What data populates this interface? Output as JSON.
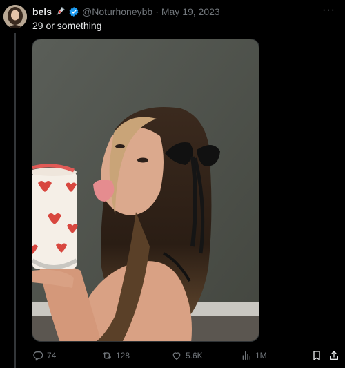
{
  "tweet": {
    "author_name": "bels",
    "handle": "@Noturhoneybb",
    "separator": "·",
    "date": "May 19, 2023",
    "text": "29 or something",
    "more_label": "···"
  },
  "stats": {
    "replies": "74",
    "retweets": "128",
    "likes": "5.6K",
    "views": "1M"
  },
  "colors": {
    "background": "#000000",
    "text": "#e7e9ea",
    "muted": "#71767b",
    "verified": "#1d9bf0"
  },
  "icons": [
    "syringe-icon",
    "verified-badge-icon",
    "reply-icon",
    "retweet-icon",
    "like-icon",
    "views-icon",
    "bookmark-icon",
    "share-icon",
    "more-icon"
  ]
}
